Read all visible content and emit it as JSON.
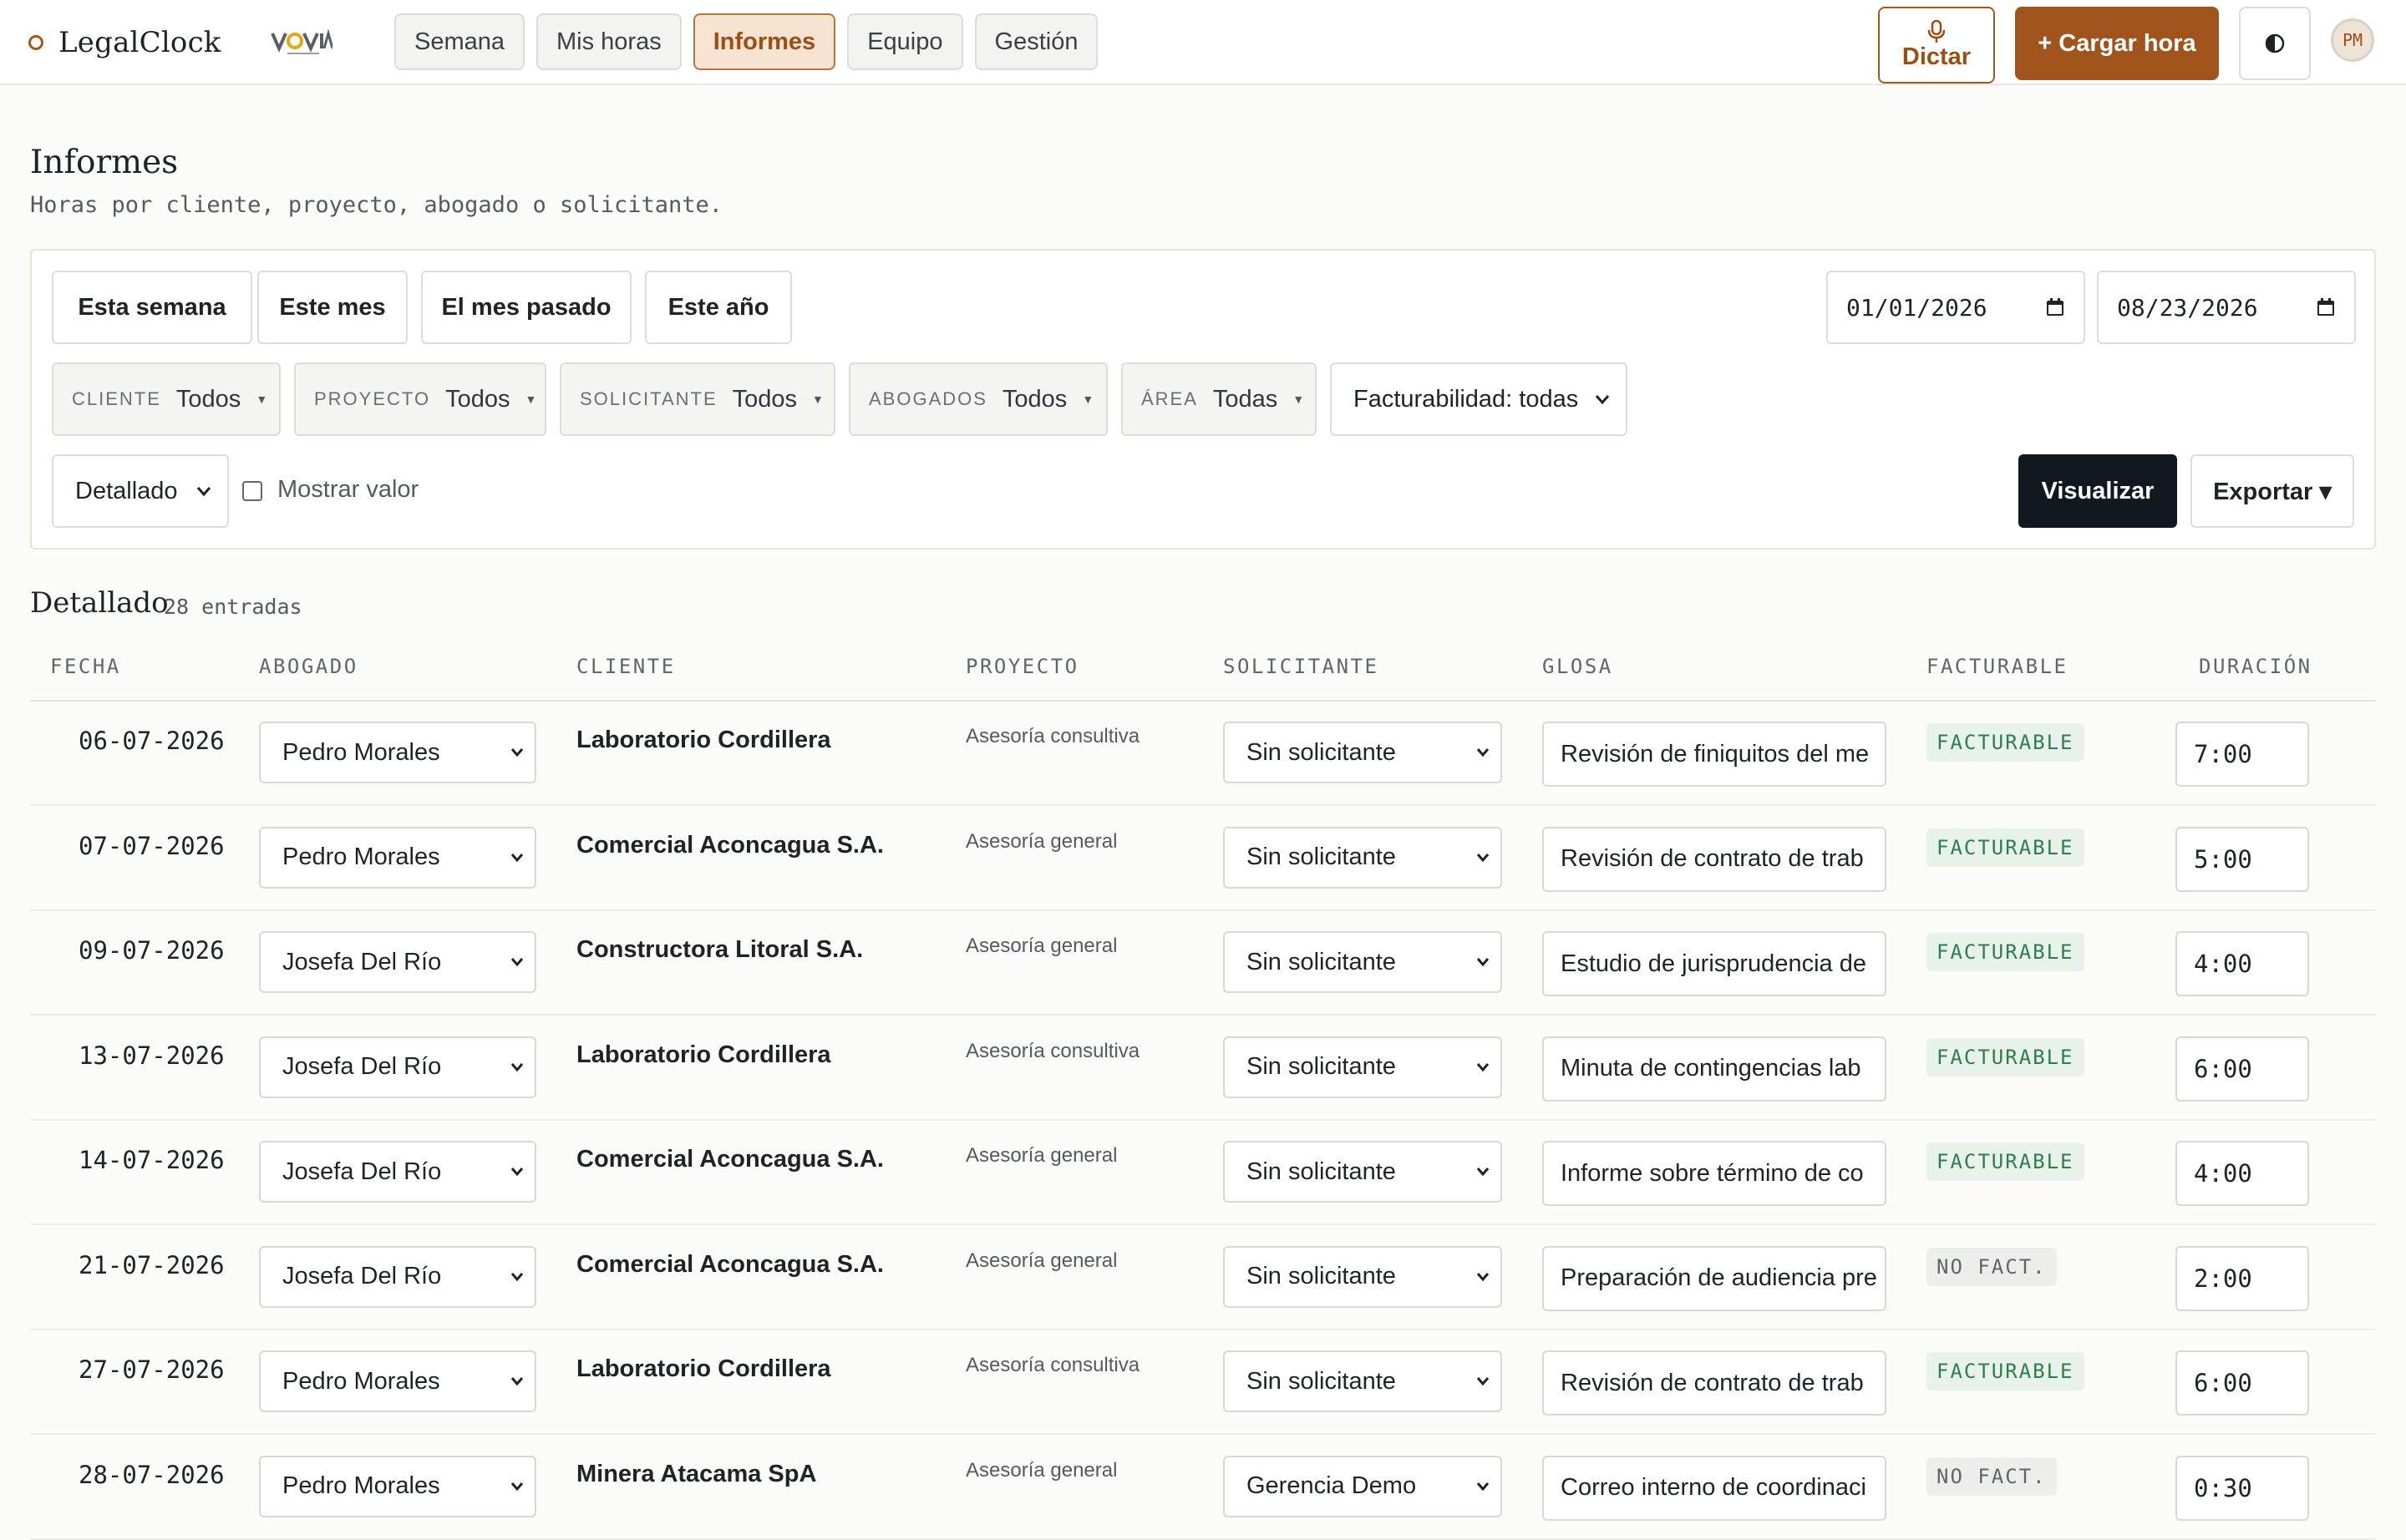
{
  "header": {
    "brand": "LegalClock",
    "partner_logo": "VOVIA",
    "nav": [
      "Semana",
      "Mis horas",
      "Informes",
      "Equipo",
      "Gestión"
    ],
    "active_tab": "Informes",
    "dictar": "Dictar",
    "cargar_hora": "+ Cargar hora",
    "avatar_initials": "PM",
    "icons": {
      "mic": "microphone-icon",
      "theme": "contrast-icon"
    }
  },
  "page": {
    "title": "Informes",
    "subtitle": "Horas por cliente, proyecto, abogado o solicitante."
  },
  "filters": {
    "quick": [
      "Esta semana",
      "Este mes",
      "El mes pasado",
      "Este año"
    ],
    "date_from": "01/01/2026",
    "date_to": "08/23/2026",
    "chips": [
      {
        "key": "CLIENTE",
        "value": "Todos"
      },
      {
        "key": "PROYECTO",
        "value": "Todos"
      },
      {
        "key": "SOLICITANTE",
        "value": "Todos"
      },
      {
        "key": "ABOGADOS",
        "value": "Todos"
      },
      {
        "key": "ÁREA",
        "value": "Todas"
      }
    ],
    "facturabilidad": "Facturabilidad: todas",
    "view_mode": "Detallado",
    "show_value_label": "Mostrar valor",
    "show_value_checked": false,
    "visualizar": "Visualizar",
    "exportar": "Exportar ▾"
  },
  "table": {
    "title": "Detallado",
    "count": "28 entradas",
    "columns": [
      "FECHA",
      "ABOGADO",
      "CLIENTE",
      "PROYECTO",
      "SOLICITANTE",
      "GLOSA",
      "FACTURABLE",
      "DURACIÓN"
    ],
    "rows": [
      {
        "fecha": "06-07-2026",
        "abogado": "Pedro Morales",
        "cliente": "Laboratorio Cordillera",
        "proyecto": "Asesoría consultiva",
        "solicitante": "Sin solicitante",
        "glosa": "Revisión de finiquitos del me",
        "facturable": "FACTURABLE",
        "duracion": "7:00"
      },
      {
        "fecha": "07-07-2026",
        "abogado": "Pedro Morales",
        "cliente": "Comercial Aconcagua S.A.",
        "proyecto": "Asesoría general",
        "solicitante": "Sin solicitante",
        "glosa": "Revisión de contrato de trab",
        "facturable": "FACTURABLE",
        "duracion": "5:00"
      },
      {
        "fecha": "09-07-2026",
        "abogado": "Josefa Del Río",
        "cliente": "Constructora Litoral S.A.",
        "proyecto": "Asesoría general",
        "solicitante": "Sin solicitante",
        "glosa": "Estudio de jurisprudencia de",
        "facturable": "FACTURABLE",
        "duracion": "4:00"
      },
      {
        "fecha": "13-07-2026",
        "abogado": "Josefa Del Río",
        "cliente": "Laboratorio Cordillera",
        "proyecto": "Asesoría consultiva",
        "solicitante": "Sin solicitante",
        "glosa": "Minuta de contingencias lab",
        "facturable": "FACTURABLE",
        "duracion": "6:00"
      },
      {
        "fecha": "14-07-2026",
        "abogado": "Josefa Del Río",
        "cliente": "Comercial Aconcagua S.A.",
        "proyecto": "Asesoría general",
        "solicitante": "Sin solicitante",
        "glosa": "Informe sobre término de co",
        "facturable": "FACTURABLE",
        "duracion": "4:00"
      },
      {
        "fecha": "21-07-2026",
        "abogado": "Josefa Del Río",
        "cliente": "Comercial Aconcagua S.A.",
        "proyecto": "Asesoría general",
        "solicitante": "Sin solicitante",
        "glosa": "Preparación de audiencia pre",
        "facturable": "NO FACT.",
        "duracion": "2:00"
      },
      {
        "fecha": "27-07-2026",
        "abogado": "Pedro Morales",
        "cliente": "Laboratorio Cordillera",
        "proyecto": "Asesoría consultiva",
        "solicitante": "Sin solicitante",
        "glosa": "Revisión de contrato de trab",
        "facturable": "FACTURABLE",
        "duracion": "6:00"
      },
      {
        "fecha": "28-07-2026",
        "abogado": "Pedro Morales",
        "cliente": "Minera Atacama SpA",
        "proyecto": "Asesoría general",
        "solicitante": "Gerencia Demo",
        "glosa": "Correo interno de coordinaci",
        "facturable": "NO FACT.",
        "duracion": "0:30"
      }
    ]
  },
  "colors": {
    "accent": "#a0541b",
    "active_tab_bg": "#f6e3d2",
    "primary_dark": "#111820",
    "billable_bg": "#e7f3ea",
    "billable_text": "#2f7d4f",
    "nonbillable_bg": "#ededeb"
  }
}
